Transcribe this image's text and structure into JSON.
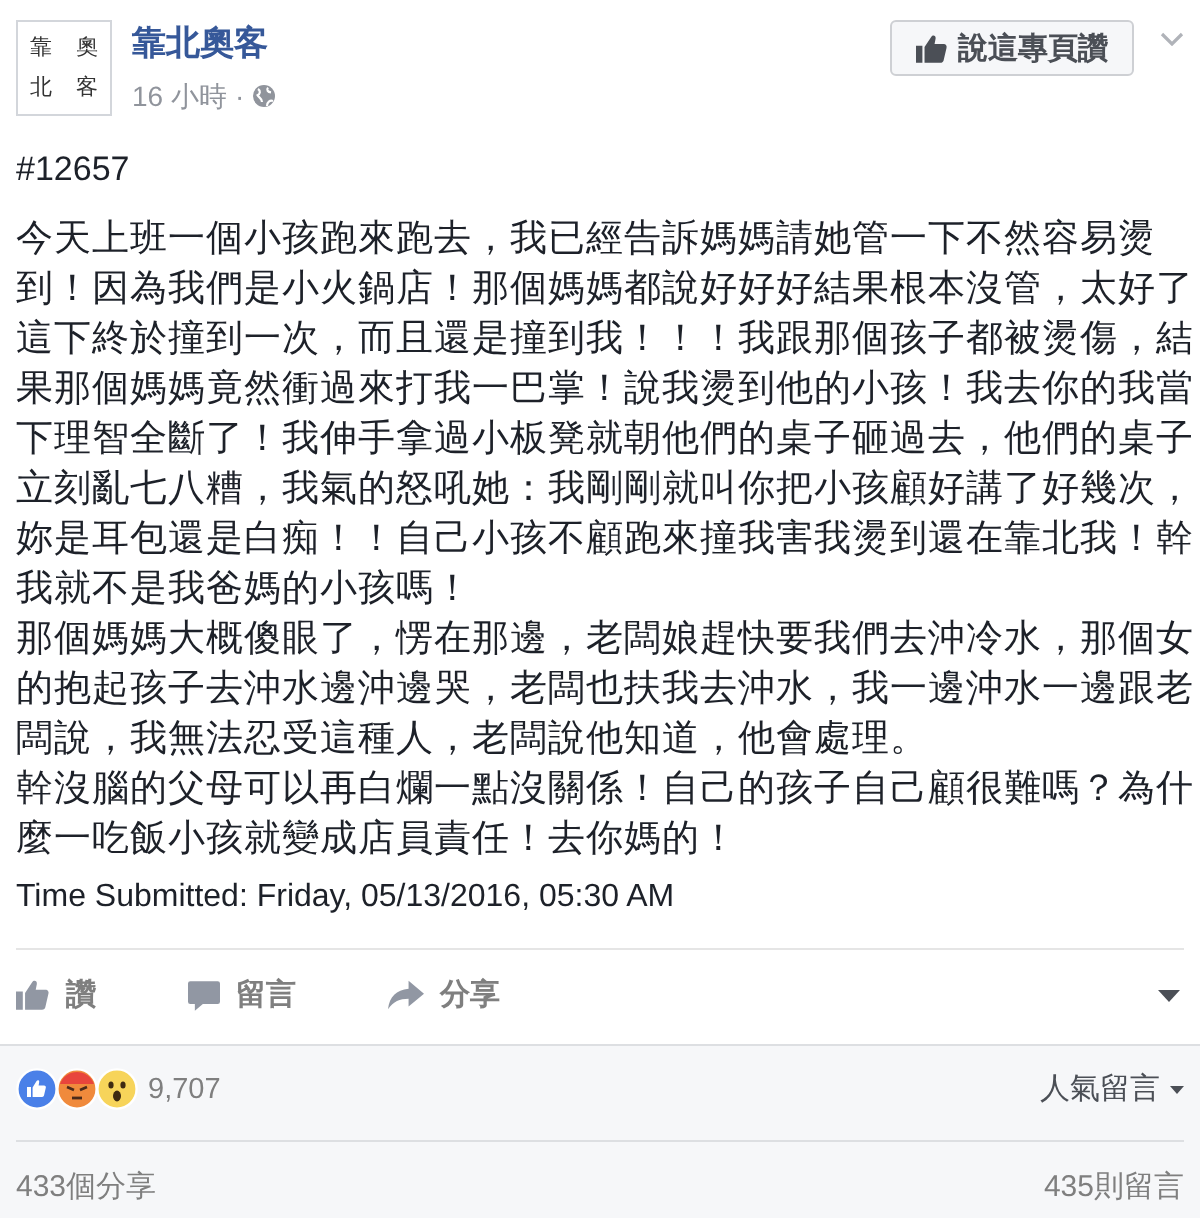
{
  "header": {
    "logo": {
      "rows": [
        "靠 奧",
        "北 客"
      ]
    },
    "page_name": "靠北奧客",
    "time": "16 小時",
    "separator": "·",
    "like_page_button": "說這專頁讚"
  },
  "post": {
    "tag": "#12657",
    "paragraphs": [
      "今天上班一個小孩跑來跑去，我已經告訴媽媽請她管一下不然容易燙到！因為我們是小火鍋店！那個媽媽都說好好好結果根本沒管，太好了這下終於撞到一次，而且還是撞到我！！！我跟那個孩子都被燙傷，結果那個媽媽竟然衝過來打我一巴掌！說我燙到他的小孩！我去你的我當下理智全斷了！我伸手拿過小板凳就朝他們的桌子砸過去，他們的桌子立刻亂七八糟，我氣的怒吼她：我剛剛就叫你把小孩顧好講了好幾次，妳是耳包還是白痴！！自己小孩不顧跑來撞我害我燙到還在靠北我！幹我就不是我爸媽的小孩嗎！",
      "那個媽媽大概傻眼了，愣在那邊，老闆娘趕快要我們去沖冷水，那個女的抱起孩子去沖水邊沖邊哭，老闆也扶我去沖水，我一邊沖水一邊跟老闆說，我無法忍受這種人，老闆說他知道，他會處理。",
      "幹沒腦的父母可以再白爛一點沒關係！自己的孩子自己顧很難嗎？為什麼一吃飯小孩就變成店員責任！去你媽的！"
    ],
    "submitted": "Time Submitted: Friday, 05/13/2016, 05:30 AM"
  },
  "actions": [
    {
      "kind": "like",
      "label": "讚"
    },
    {
      "kind": "comment",
      "label": "留言"
    },
    {
      "kind": "share",
      "label": "分享"
    }
  ],
  "summary": {
    "reaction_count": "9,707",
    "sort": "人氣留言",
    "shares": "433個分享",
    "comments": "435則留言"
  }
}
